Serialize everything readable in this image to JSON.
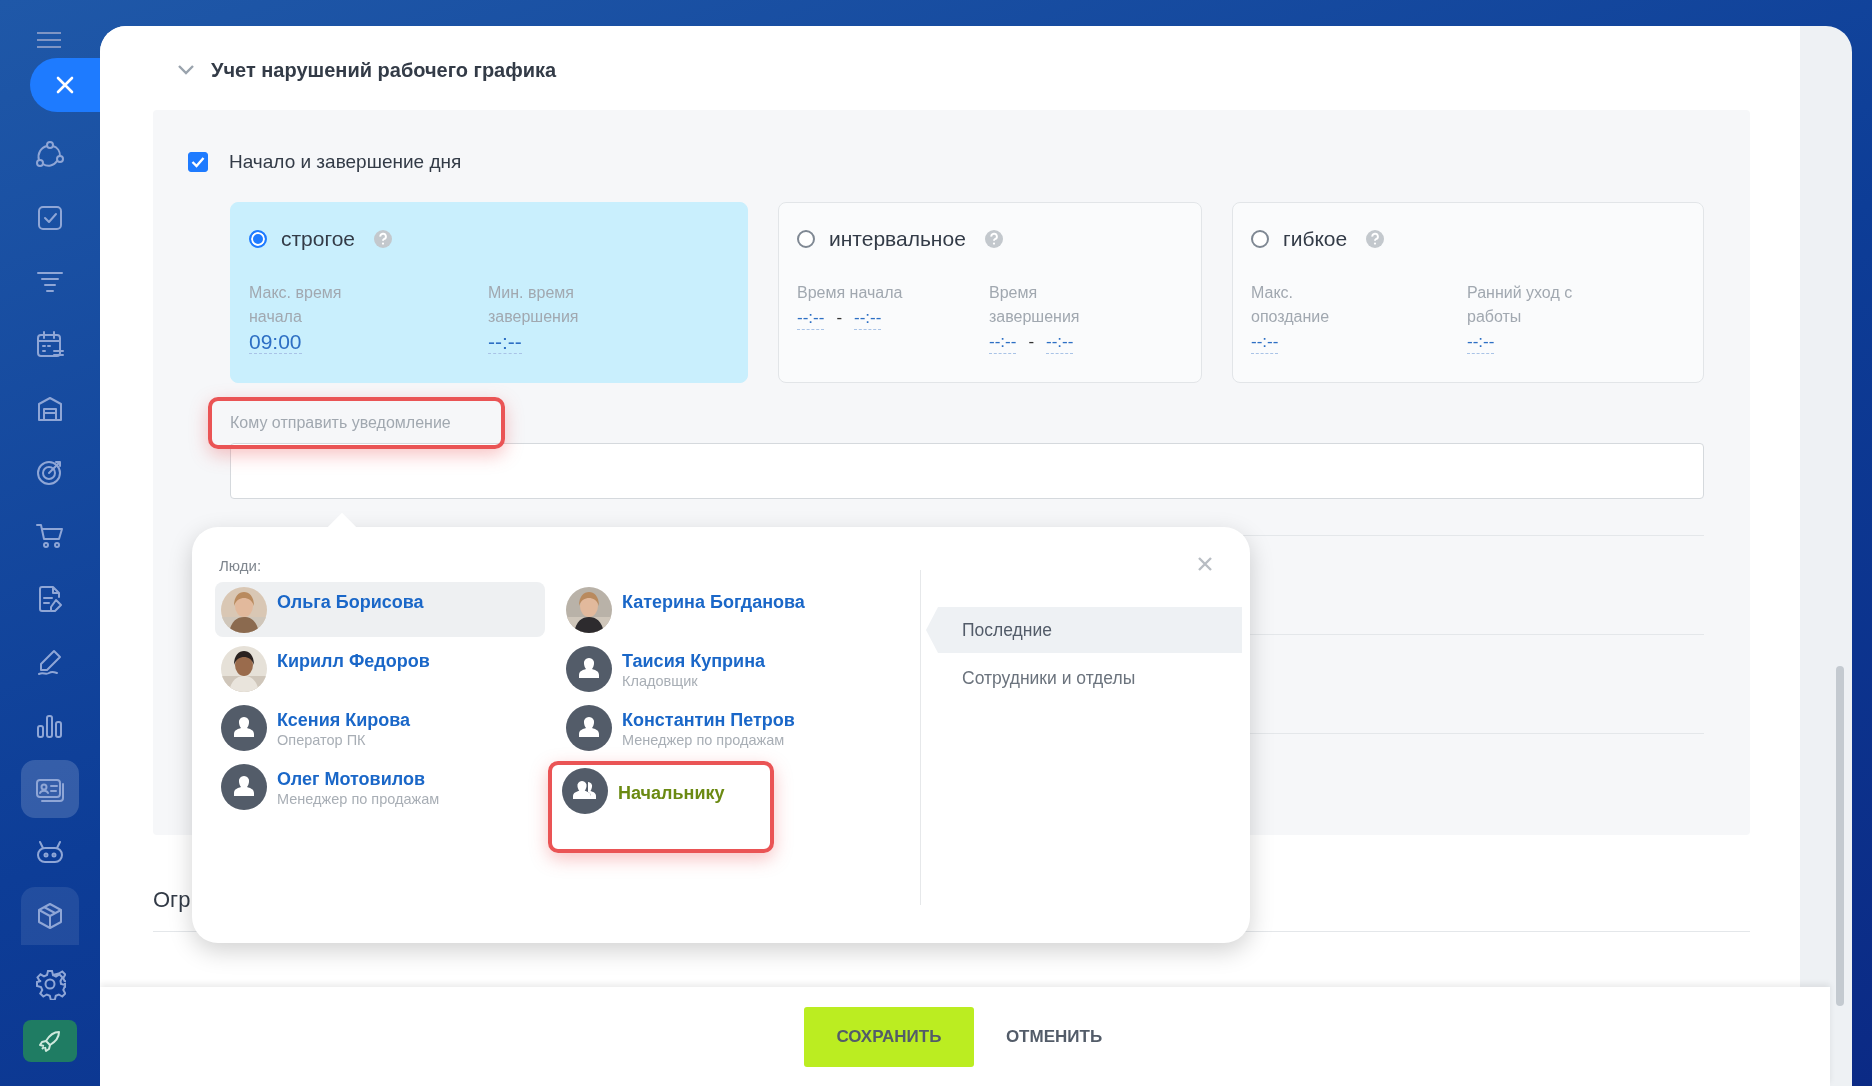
{
  "sidebar": {
    "items": [
      {
        "selected": false
      },
      {
        "selected": false
      },
      {
        "selected": false
      },
      {
        "selected": false
      },
      {
        "selected": false
      },
      {
        "selected": false
      },
      {
        "selected": false
      },
      {
        "selected": false
      },
      {
        "selected": false
      },
      {
        "selected": false
      },
      {
        "selected": true
      },
      {
        "selected": false
      }
    ]
  },
  "section": {
    "title": "Учет нарушений рабочего графика",
    "expanded": true
  },
  "day_control": {
    "label": "Начало и завершение дня",
    "checked": true
  },
  "modes": [
    {
      "label": "строгое",
      "selected": true,
      "fields": [
        {
          "label": "Макс. время начала",
          "values": [
            "09:00"
          ]
        },
        {
          "label": "Мин. время завершения",
          "values": [
            "--:--"
          ]
        }
      ]
    },
    {
      "label": "интервальное",
      "selected": false,
      "fields": [
        {
          "label": "Время начала",
          "values": [
            "--:--",
            "--:--"
          ],
          "separator": "-"
        },
        {
          "label": "Время завершения",
          "values": [
            "--:--",
            "--:--"
          ],
          "separator": "-"
        }
      ]
    },
    {
      "label": "гибкое",
      "selected": false,
      "fields": [
        {
          "label": "Макс. опоздание",
          "values": [
            "--:--"
          ]
        },
        {
          "label": "Ранний уход с работы",
          "values": [
            "--:--"
          ]
        }
      ]
    }
  ],
  "notify": {
    "label": "Кому отправить уведомление",
    "highlighted": true
  },
  "next_section_title": "Огр",
  "popup": {
    "group_label": "Люди:",
    "items": [
      {
        "name": "Ольга Борисова",
        "selected": true,
        "highlighted": false
      },
      {
        "name": "Катерина Богданова",
        "selected": false,
        "highlighted": false
      },
      {
        "name": "Кирилл Федоров",
        "selected": false,
        "highlighted": false
      },
      {
        "name": "Таисия Куприна",
        "position": "Кладовщик",
        "kind": "person",
        "selected": false,
        "highlighted": false
      },
      {
        "name": "Ксения Кирова",
        "position": "Оператор ПК",
        "kind": "person",
        "selected": false,
        "highlighted": false
      },
      {
        "name": "Константин Петров",
        "position": "Менеджер по продажам",
        "kind": "person",
        "selected": false,
        "highlighted": false
      },
      {
        "name": "Олег Мотовилов",
        "position": "Менеджер по продажам",
        "kind": "person",
        "selected": false,
        "highlighted": false
      },
      {
        "name": "Начальнику",
        "kind": "group",
        "selected": false,
        "highlighted": true
      }
    ],
    "tabs": [
      {
        "label": "Последние",
        "selected": true
      },
      {
        "label": "Сотрудники и отделы",
        "selected": false
      }
    ]
  },
  "buttons": {
    "save": "СОХРАНИТЬ",
    "cancel": "ОТМЕНИТЬ"
  }
}
